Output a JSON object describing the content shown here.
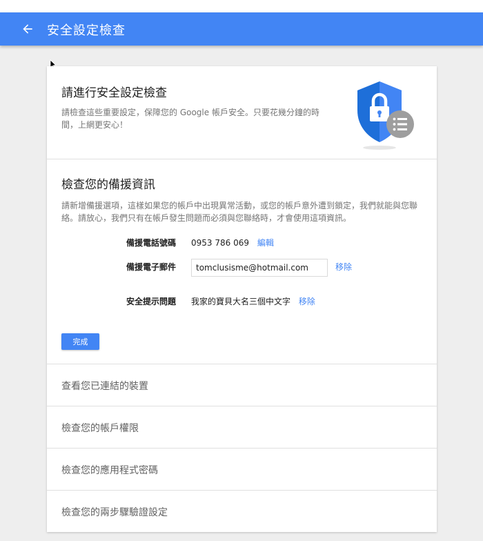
{
  "appbar": {
    "title": "安全設定檢查",
    "color": "#4285f4"
  },
  "intro": {
    "title": "請進行安全設定檢查",
    "description": "請檢查這些重要設定，保障您的 Google 帳戶安全。只要花幾分鐘的時間，上網更安心！"
  },
  "backup": {
    "title": "檢查您的備援資訊",
    "description": "請新增備援選項，這樣如果您的帳戶中出現異常活動，或您的帳戶意外遭到鎖定，我們就能與您聯絡。請放心，我們只有在帳戶發生問題而必須與您聯絡時，才會使用這項資訊。",
    "phone": {
      "label": "備援電話號碼",
      "value": "0953 786 069",
      "action": "編輯"
    },
    "email": {
      "label": "備援電子郵件",
      "value": "tomclusisme@hotmail.com",
      "action": "移除"
    },
    "question": {
      "label": "安全提示問題",
      "value": "我家的寶貝大名三個中文字",
      "action": "移除"
    },
    "done_label": "完成"
  },
  "sections": [
    {
      "label": "查看您已連結的裝置"
    },
    {
      "label": "檢查您的帳戶權限"
    },
    {
      "label": "檢查您的應用程式密碼"
    },
    {
      "label": "檢查您的兩步驟驗證設定"
    }
  ],
  "icons": {
    "back": "arrow-back-icon",
    "shield": "shield-lock-icon",
    "badge": "list-icon",
    "cursor": "mouse-cursor-icon"
  }
}
